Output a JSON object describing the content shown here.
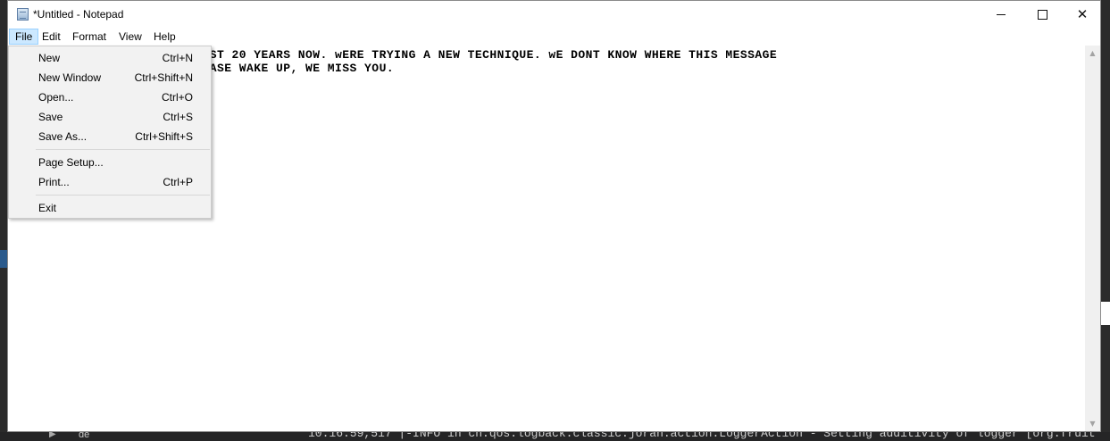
{
  "window": {
    "title": "*Untitled - Notepad",
    "controls": {
      "minimize": "–",
      "maximize": "☐",
      "close": "✕"
    }
  },
  "menubar": {
    "items": [
      {
        "label": "File"
      },
      {
        "label": "Edit"
      },
      {
        "label": "Format"
      },
      {
        "label": "View"
      },
      {
        "label": "Help"
      }
    ]
  },
  "file_menu": {
    "items": [
      {
        "label": "New",
        "shortcut": "Ctrl+N"
      },
      {
        "label": "New Window",
        "shortcut": "Ctrl+Shift+N"
      },
      {
        "label": "Open...",
        "shortcut": "Ctrl+O"
      },
      {
        "label": "Save",
        "shortcut": "Ctrl+S"
      },
      {
        "label": "Save As...",
        "shortcut": "Ctrl+Shift+S"
      },
      {
        "label": "Page Setup...",
        "shortcut": ""
      },
      {
        "label": "Print...",
        "shortcut": "Ctrl+P"
      },
      {
        "label": "Exit",
        "shortcut": ""
      }
    ]
  },
  "editor": {
    "line1": "UVE BEEN IN A COMA FOR ALMOST 20 YEARS NOW. wERE TRYING A NEW TECHNIQUE. wE DONT KNOW WHERE THIS MESSAGE",
    "line2": ", BUT WE HOPE IT WORKS. pLEASE WAKE UP, WE MISS YOU."
  },
  "background": {
    "bottom_tree_label": "de",
    "bottom_log_text": "10:16:59,517 |-INFO in ch.qos.logback.classic.joran.action.LoggerAction - Setting additivity of logger [org.fruit"
  },
  "icons": {
    "app": "notepad-icon",
    "scroll_up": "scroll-up-arrow-icon",
    "scroll_down": "scroll-down-arrow-icon"
  }
}
